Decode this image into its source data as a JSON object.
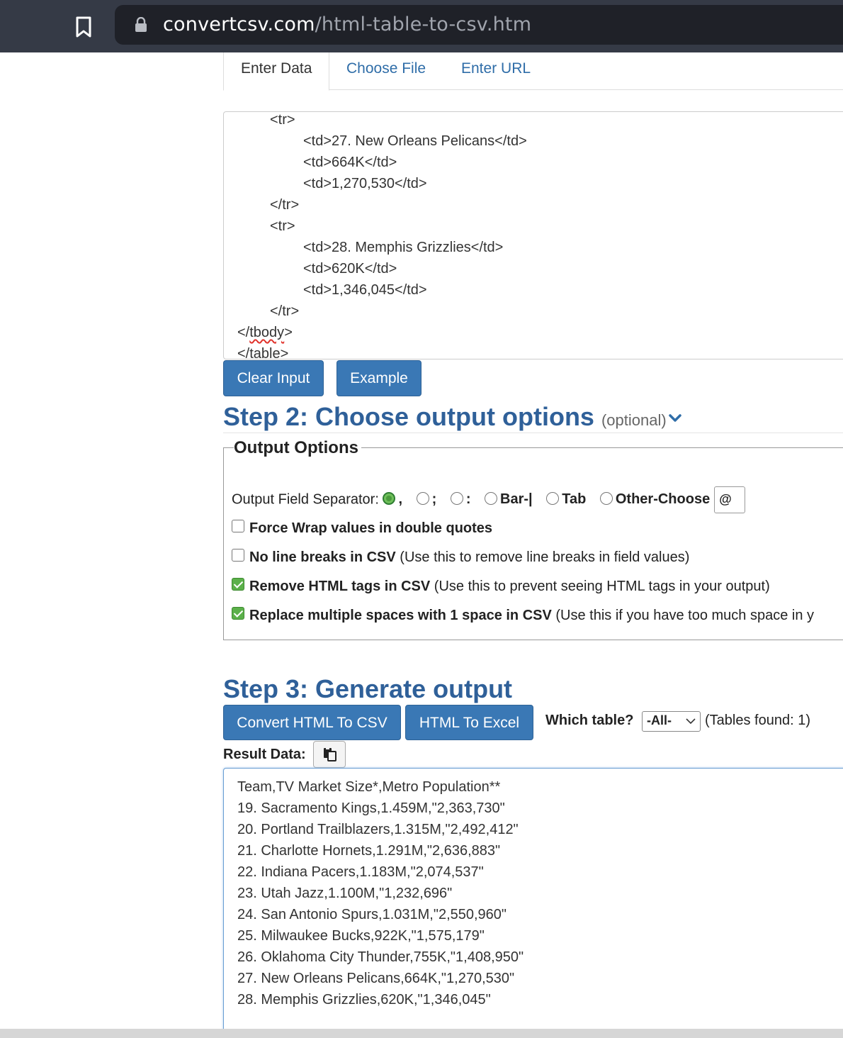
{
  "browser": {
    "url_host": "convertcsv.com",
    "url_path": "/html-table-to-csv.htm",
    "icons": {
      "bookmark": "bookmark-icon",
      "lock": "lock-icon"
    }
  },
  "tabs": [
    {
      "label": "Enter Data",
      "active": true
    },
    {
      "label": "Choose File",
      "active": false
    },
    {
      "label": "Enter URL",
      "active": false
    }
  ],
  "input": {
    "lines": [
      {
        "indent": 1,
        "text": "<tr>"
      },
      {
        "indent": 2,
        "text": "<td>27. New Orleans Pelicans</td>"
      },
      {
        "indent": 2,
        "text": "<td>664K</td>"
      },
      {
        "indent": 2,
        "text": "<td>1,270,530</td>"
      },
      {
        "indent": 1,
        "text": "</tr>"
      },
      {
        "indent": 1,
        "text": "<tr>"
      },
      {
        "indent": 2,
        "text": "<td>28. Memphis Grizzlies</td>"
      },
      {
        "indent": 2,
        "text": "<td>620K</td>"
      },
      {
        "indent": 2,
        "text": "<td>1,346,045</td>"
      },
      {
        "indent": 1,
        "text": "</tr>"
      },
      {
        "indent": 0,
        "text": "</tbody>"
      },
      {
        "indent": 0,
        "text": "</table>"
      }
    ],
    "clear_label": "Clear Input",
    "example_label": "Example"
  },
  "step2": {
    "title": "Step 2: Choose output options",
    "optional": "(optional)",
    "legend": "Output Options",
    "separator_label": "Output Field Separator:",
    "separators": [
      {
        "label": ",",
        "selected": true
      },
      {
        "label": ";",
        "selected": false
      },
      {
        "label": ":",
        "selected": false
      },
      {
        "label": "Bar-|",
        "selected": false
      },
      {
        "label": "Tab",
        "selected": false
      },
      {
        "label": "Other-Choose",
        "selected": false
      }
    ],
    "other_value": "@",
    "options": {
      "force_wrap": {
        "label": "Force Wrap values in double quotes",
        "note": "",
        "checked": false
      },
      "no_linebreaks": {
        "label": "No line breaks in CSV",
        "note": "(Use this to remove line breaks in field values)",
        "checked": false
      },
      "remove_html": {
        "label": "Remove HTML tags in CSV",
        "note": "(Use this to prevent seeing HTML tags in your output)",
        "checked": true
      },
      "replace_spaces": {
        "label": "Replace multiple spaces with 1 space in CSV",
        "note": "(Use this if you have too much space in y",
        "checked": true
      }
    }
  },
  "step3": {
    "title": "Step 3: Generate output",
    "convert_label": "Convert HTML To CSV",
    "excel_label": "HTML To Excel",
    "which_table_label": "Which table?",
    "table_select_value": "-All-",
    "tables_found": "(Tables found: 1)",
    "result_label": "Result Data:",
    "copy_icon": "clipboard-copy-icon",
    "result_lines": [
      "Team,TV Market Size*,Metro Population**",
      "19. Sacramento Kings,1.459M,\"2,363,730\"",
      "20. Portland Trailblazers,1.315M,\"2,492,412\"",
      "21. Charlotte Hornets,1.291M,\"2,636,883\"",
      "22. Indiana Pacers,1.183M,\"2,074,537\"",
      "23. Utah Jazz,1.100M,\"1,232,696\"",
      "24. San Antonio Spurs,1.031M,\"2,550,960\"",
      "25. Milwaukee Bucks,922K,\"1,575,179\"",
      "26. Oklahoma City Thunder,755K,\"1,408,950\"",
      "27. New Orleans Pelicans,664K,\"1,270,530\"",
      "28. Memphis Grizzlies,620K,\"1,346,045\""
    ]
  },
  "colors": {
    "accent": "#3a78b5",
    "heading": "#2f6099",
    "link": "#2f6da8",
    "checked": "#5bb04a"
  }
}
